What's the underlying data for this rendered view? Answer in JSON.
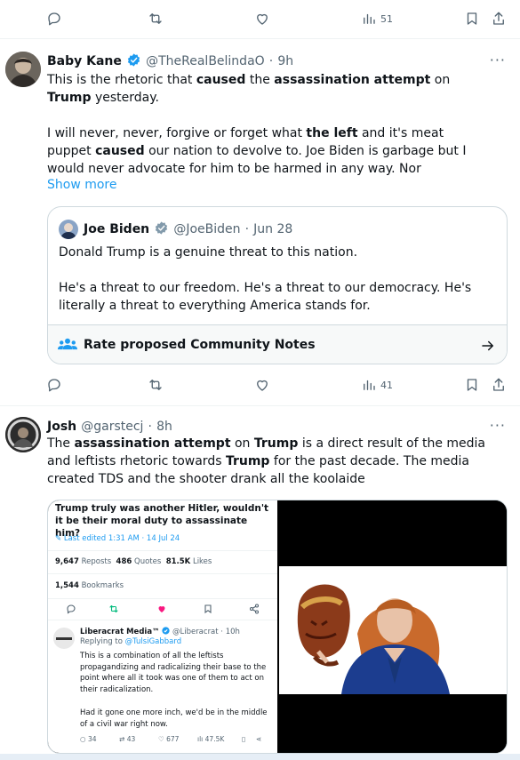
{
  "top_actions": {
    "views": "51"
  },
  "tweet1": {
    "name": "Baby Kane",
    "handle": "@TheRealBelindaO",
    "time": "9h",
    "p1": [
      {
        "t": "This is the rhetoric that ",
        "b": false
      },
      {
        "t": "caused",
        "b": true
      },
      {
        "t": " the ",
        "b": false
      },
      {
        "t": "assassination attempt",
        "b": true
      },
      {
        "t": " on ",
        "b": false
      },
      {
        "t": "Trump",
        "b": true
      },
      {
        "t": " yesterday.",
        "b": false
      }
    ],
    "p2": [
      {
        "t": "I will never, never, forgive or forget what ",
        "b": false
      },
      {
        "t": "the left",
        "b": true
      },
      {
        "t": " and it's meat puppet ",
        "b": false
      },
      {
        "t": "caused",
        "b": true
      },
      {
        "t": " our nation to devolve to.  Joe Biden is garbage but I would never advocate for him to be harmed in any way.  Nor",
        "b": false
      }
    ],
    "show_more": "Show more",
    "views": "41"
  },
  "quote": {
    "name": "Joe Biden",
    "handle": "@JoeBiden",
    "time": "Jun 28",
    "line1": "Donald Trump is a genuine threat to this nation.",
    "line2": "He's a threat to our freedom. He's a threat to our democracy. He's literally a threat to everything America stands for.",
    "notes_label": "Rate proposed Community Notes"
  },
  "tweet2": {
    "name": "Josh",
    "handle": "@garstecj",
    "time": "8h",
    "p1": [
      {
        "t": "The ",
        "b": false
      },
      {
        "t": "assassination attempt",
        "b": true
      },
      {
        "t": " on ",
        "b": false
      },
      {
        "t": "Trump",
        "b": true
      },
      {
        "t": " is a direct result of the media and leftists rhetoric towards ",
        "b": false
      },
      {
        "t": "Trump",
        "b": true
      },
      {
        "t": " for the past decade. The media created TDS and the shooter drank all the koolaide",
        "b": false
      }
    ]
  },
  "embedded": {
    "title": "Trump truly was another Hitler, wouldn't it be their moral duty to assassinate him?",
    "edited": "Last edited 1:31 AM · 14 Jul 24",
    "reposts_n": "9,647",
    "reposts_l": "Reposts",
    "quotes_n": "486",
    "quotes_l": "Quotes",
    "likes_n": "81.5K",
    "likes_l": "Likes",
    "bookmarks_n": "1,544",
    "bookmarks_l": "Bookmarks",
    "reply_name": "Liberacrat Media™",
    "reply_handle": "@Liberacrat · 10h",
    "replying_prefix": "Replying to ",
    "replying_to": "@TulsiGabbard",
    "reply_p1": "This is a combination of all the leftists propagandizing and radicalizing their base to the point where all it took was one of them to act on their radicalization.",
    "reply_p2": "Had it gone one more inch, we'd be in the middle of a civil war right now.",
    "r_replies": "34",
    "r_reposts": "43",
    "r_likes": "677",
    "r_views": "47.5K"
  }
}
